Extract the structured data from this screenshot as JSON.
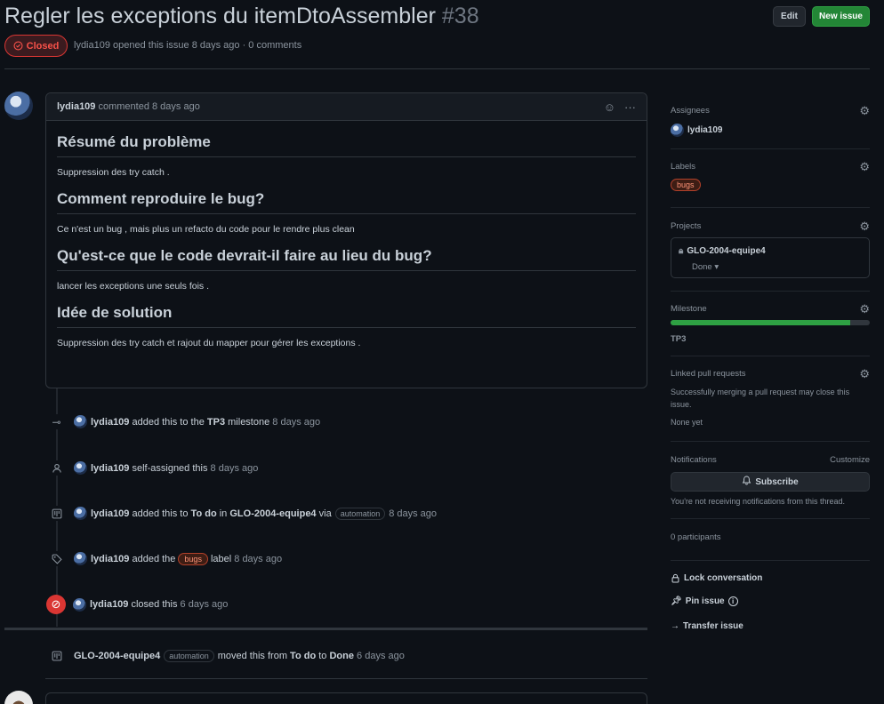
{
  "header": {
    "title": "Regler les exceptions du itemDtoAssembler",
    "number": "#38",
    "edit_label": "Edit",
    "new_issue_label": "New issue",
    "state": "Closed",
    "author": "lydia109",
    "meta_text": "opened this issue 8 days ago · 0 comments"
  },
  "comment": {
    "author": "lydia109",
    "time": "commented 8 days ago",
    "sections": [
      {
        "heading": "Résumé du problème",
        "text": "Suppression des try catch ."
      },
      {
        "heading": "Comment reproduire le bug?",
        "text": "Ce n'est un bug , mais plus un refacto du code pour le rendre plus clean"
      },
      {
        "heading": "Qu'est-ce que le code devrait-il faire au lieu du bug?",
        "text": "lancer les exceptions une seuls fois ."
      },
      {
        "heading": "Idée de solution",
        "text": "Suppression des try catch et rajout du mapper pour gérer les exceptions ."
      }
    ]
  },
  "timeline": {
    "milestone": {
      "actor": "lydia109",
      "pre": "added this to the",
      "target": "TP3",
      "post": "milestone",
      "time": "8 days ago"
    },
    "assign": {
      "actor": "lydia109",
      "text": "self-assigned this",
      "time": "8 days ago"
    },
    "project_add": {
      "actor": "lydia109",
      "pre": "added this to",
      "column": "To do",
      "mid": "in",
      "project": "GLO-2004-equipe4",
      "via": "via",
      "bot": "automation",
      "time": "8 days ago"
    },
    "label": {
      "actor": "lydia109",
      "pre": "added the",
      "label": "bugs",
      "post": "label",
      "time": "8 days ago"
    },
    "closed": {
      "actor": "lydia109",
      "text": "closed this",
      "time": "6 days ago"
    },
    "moved": {
      "project": "GLO-2004-equipe4",
      "bot": "automation",
      "pre": "moved this from",
      "from": "To do",
      "to_word": "to",
      "to": "Done",
      "time": "6 days ago"
    }
  },
  "sidebar": {
    "assignees_title": "Assignees",
    "assignee": "lydia109",
    "labels_title": "Labels",
    "label": "bugs",
    "projects_title": "Projects",
    "project_name": "GLO-2004-equipe4",
    "project_status": "Done",
    "milestone_title": "Milestone",
    "milestone_progress": 0.9,
    "milestone_name": "TP3",
    "linked_title": "Linked pull requests",
    "linked_desc": "Successfully merging a pull request may close this issue.",
    "linked_none": "None yet",
    "notifications_title": "Notifications",
    "customize": "Customize",
    "subscribe": "Subscribe",
    "notif_desc": "You're not receiving notifications from this thread.",
    "participants": "0 participants",
    "lock": "Lock conversation",
    "pin": "Pin issue",
    "transfer": "Transfer issue"
  },
  "colors": {
    "closed": "#f85149",
    "green": "#238636",
    "label_bugs": "#ff9478"
  }
}
